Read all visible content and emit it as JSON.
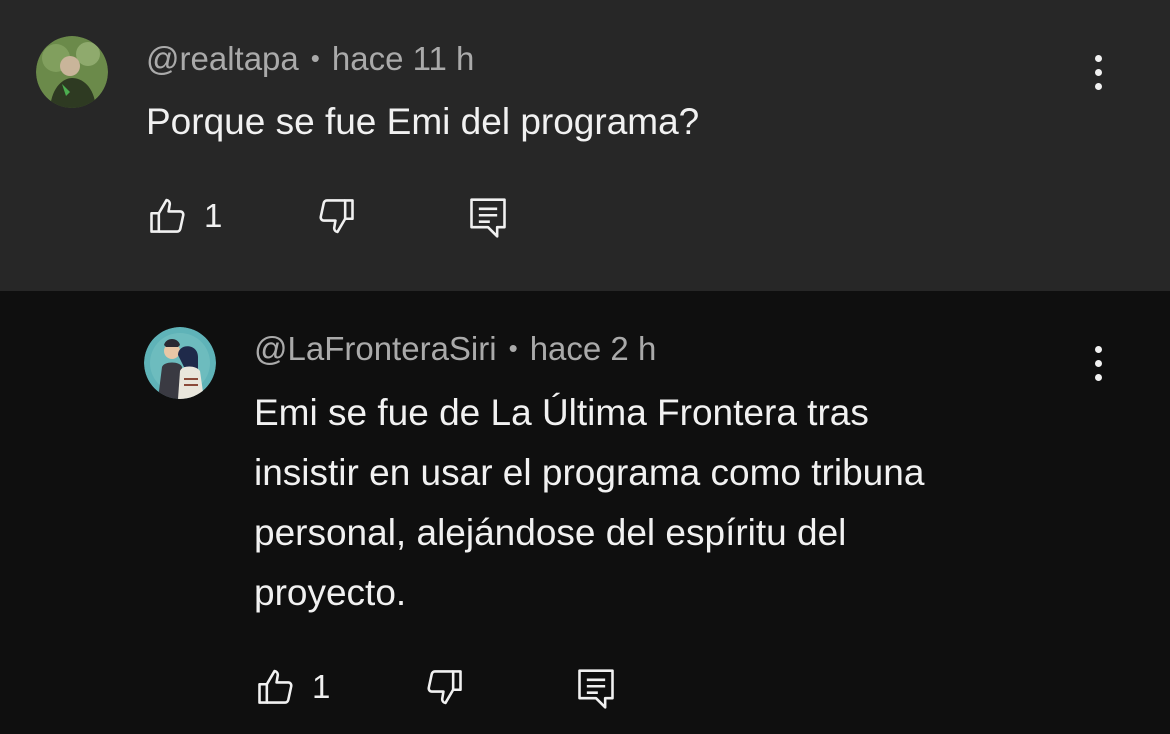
{
  "comments": [
    {
      "handle": "@realtapa",
      "time": "hace 11 h",
      "text": "Porque se fue Emi del programa?",
      "likes": "1",
      "avatar_colors": {
        "bg": "#5e7a3a",
        "fg": "#b9c9a0"
      }
    },
    {
      "handle": "@LaFronteraSiri",
      "time": "hace 2 h",
      "text": "Emi se fue de La Última Frontera tras\ninsistir en usar el programa como tribuna\npersonal, alejándose del espíritu del\nproyecto.",
      "likes": "1",
      "avatar_colors": {
        "bg": "#5fb3b8",
        "fg": "#2a2a3a"
      }
    }
  ],
  "icons": {
    "like": "thumb-up-icon",
    "dislike": "thumb-down-icon",
    "reply": "reply-comment-icon",
    "more": "more-vertical-icon"
  },
  "separator": "•"
}
